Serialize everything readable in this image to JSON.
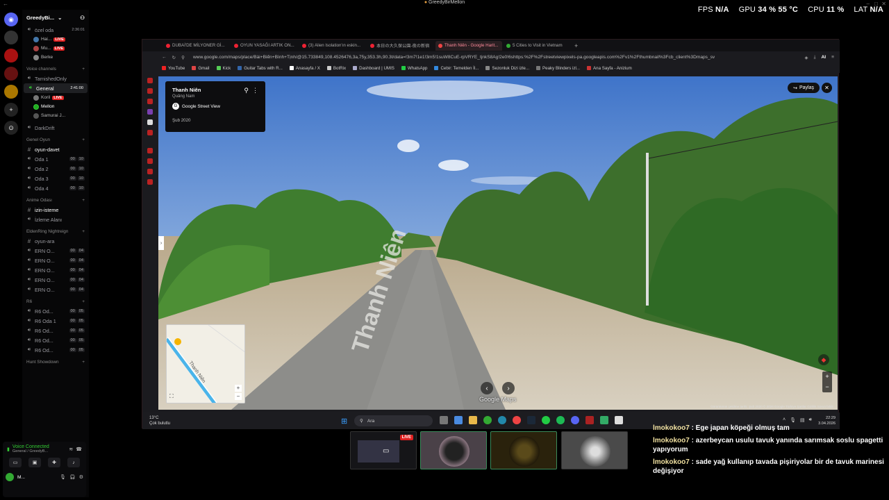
{
  "window": {
    "title": "GreedyBirMellon"
  },
  "hud": {
    "fps_label": "FPS",
    "fps": "N/A",
    "gpu_label": "GPU",
    "gpu": "34 % 55 °C",
    "cpu_label": "CPU",
    "cpu": "11 %",
    "lat_label": "LAT",
    "lat": "N/A"
  },
  "discord": {
    "server_name": "GreedyBi...",
    "ozel_oda": "özel oda",
    "ozel_oda_time": "2:36:01",
    "ozel_users": [
      {
        "name": "Hai...",
        "live": "LIVE"
      },
      {
        "name": "Mu...",
        "live": "LIVE"
      },
      {
        "name": "Berke",
        "live": ""
      }
    ],
    "cat_voice": "Voice channels",
    "ch_tarnished": "TarnishedOnly",
    "ch_general": "General",
    "general_time": "2:41:00",
    "general_users": [
      {
        "name": "Koril",
        "live": "LIVE"
      },
      {
        "name": "Mellon",
        "live": ""
      },
      {
        "name": "Samurai J...",
        "live": ""
      }
    ],
    "ch_darkdrift": "DarkDrift",
    "cat_genel_oyun": "Genel Oyun",
    "ch_oyun_davet": "oyun-davet",
    "oda": [
      {
        "name": "Oda 1",
        "a": "00",
        "b": "10"
      },
      {
        "name": "Oda 2",
        "a": "00",
        "b": "10"
      },
      {
        "name": "Oda 3",
        "a": "00",
        "b": "10"
      },
      {
        "name": "Oda 4",
        "a": "00",
        "b": "10"
      }
    ],
    "cat_anime": "Anime Odası",
    "ch_izin": "izin-isteme",
    "ch_izleme": "İzleme Alanı",
    "cat_elden": "EldenRing Nightreign",
    "ch_oyun_ara": "oyun-ara",
    "ern": [
      {
        "name": "ERN O...",
        "a": "00",
        "b": "04"
      },
      {
        "name": "ERN O...",
        "a": "00",
        "b": "04"
      },
      {
        "name": "ERN O...",
        "a": "00",
        "b": "04"
      },
      {
        "name": "ERN O...",
        "a": "00",
        "b": "04"
      },
      {
        "name": "ERN O...",
        "a": "00",
        "b": "04"
      }
    ],
    "cat_r6": "R6",
    "r6": [
      {
        "name": "R6 Od...",
        "a": "00",
        "b": "05"
      },
      {
        "name": "R6 Oda 1",
        "a": "00",
        "b": "05"
      },
      {
        "name": "R6 Od...",
        "a": "00",
        "b": "05"
      },
      {
        "name": "R6 Od...",
        "a": "00",
        "b": "05"
      },
      {
        "name": "R6 Od...",
        "a": "00",
        "b": "05"
      }
    ],
    "cat_hunt": "Hunt Showdown",
    "voice_connected": "Voice Connected",
    "voice_sub": "General / GreedyB...",
    "me_name": "M..."
  },
  "browser": {
    "tabs": [
      {
        "label": "DUBAİ'DE MİLYONER Gİ..."
      },
      {
        "label": "OYUN YASAĞI ARTIK ON..."
      },
      {
        "label": "(3) Alien Isolation'ın eskin..."
      },
      {
        "label": "本日の大久保公園-夜の新宿"
      },
      {
        "label": "Thanh Niên - Google Harit..."
      },
      {
        "label": "5 Cities to Visit in Vietnam"
      }
    ],
    "url": "www.google.com/maps/place/Bài+Biển+Bình+Tịnh/@15.733849,108.4526476,3a,75y,353.3h,90.3t/data=!3m7!1e1!3m5!1suW8CuE-rpVRYE_tjnkS8Ag!2e0!6shttps:%2F%2Fstreetviewpixels-pa.googleapis.com%2Fv1%2Fthumbnail%3Fcb_client%3Dmaps_sv",
    "ai_label": "AI",
    "bookmarks": [
      {
        "label": "YouTube",
        "color": "#e22"
      },
      {
        "label": "Gmail",
        "color": "#d44"
      },
      {
        "label": "Kick",
        "color": "#5c5"
      },
      {
        "label": "Guitar Tabs with R...",
        "color": "#36a"
      },
      {
        "label": "Anasayfa / X",
        "color": "#fff"
      },
      {
        "label": "BotRix",
        "color": "#ccc"
      },
      {
        "label": "Dashboard | UMIS",
        "color": "#aac"
      },
      {
        "label": "WhatsApp",
        "color": "#2c4"
      },
      {
        "label": "Cebir: Temelden İl...",
        "color": "#38d"
      },
      {
        "label": "Sezonluk Dizi izle...",
        "color": "#888"
      },
      {
        "label": "Peaky Blinders izl...",
        "color": "#777"
      },
      {
        "label": "Ana Sayfa - Anizium",
        "color": "#c33"
      }
    ]
  },
  "streetview": {
    "place": "Thanh Niên",
    "region": "Quảng Nam",
    "provider": "Google Street View",
    "date": "Şub 2020",
    "share": "Paylaş",
    "road_label": "Thanh Niên",
    "minimap_road": "Thanh Niên",
    "logo": "Google Maps",
    "copyright": "Görüntünün çekilme tarihi: Şub 2020   © 2026 Google   Türkiye   Şartlar   Gizlilik   Sorun bildir"
  },
  "taskbar": {
    "temp": "13°C",
    "weather": "Çok bulutlu",
    "search": "Ara",
    "time": "22:29",
    "date": "3.04.2026"
  },
  "preview_live": "LIVE",
  "chat": [
    {
      "user": "lmokokoo7",
      "text": " : Ege japan köpeği olmuş tam"
    },
    {
      "user": "lmokokoo7",
      "text": " : azerbeycan usulu tavuk yanında sarımsak soslu spagetti yapıyorum"
    },
    {
      "user": "lmokokoo7",
      "text": " : sade yağ kullanıp tavada pişiriyolar bir de tavuk marinesi değişiyor"
    }
  ]
}
